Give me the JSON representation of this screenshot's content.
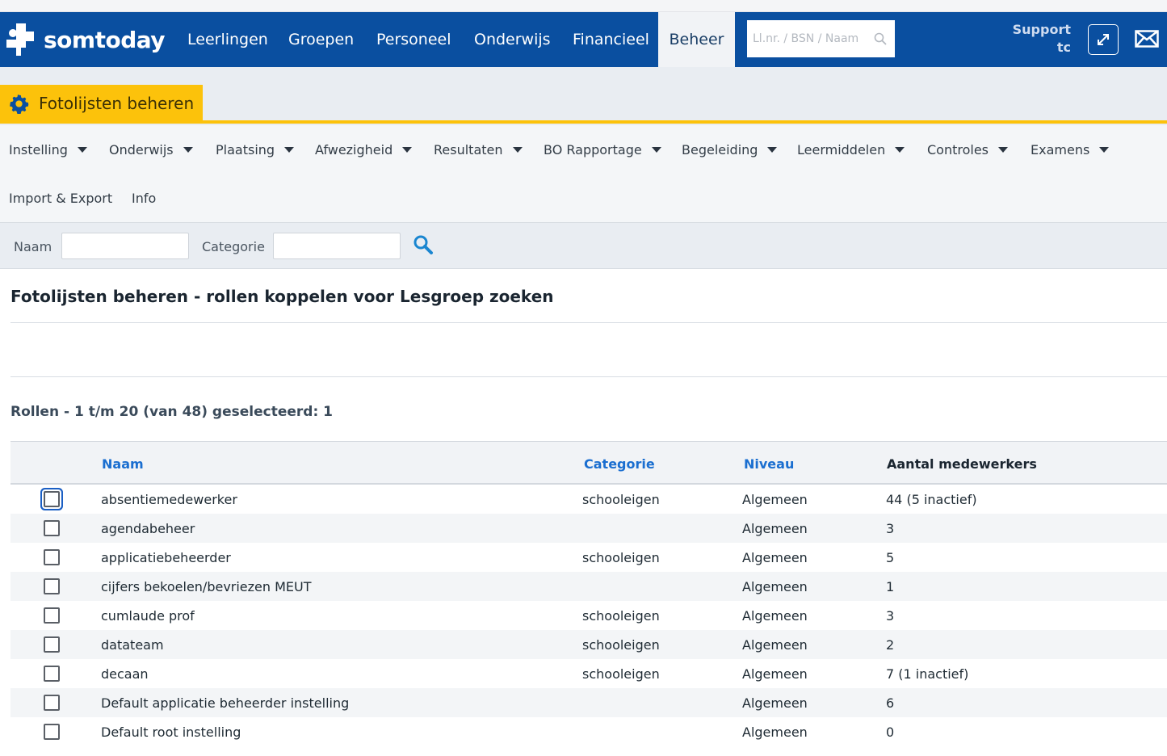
{
  "topnav": {
    "logo_text": "somtoday",
    "items": [
      {
        "label": "Leerlingen"
      },
      {
        "label": "Groepen"
      },
      {
        "label": "Personeel"
      },
      {
        "label": "Onderwijs"
      },
      {
        "label": "Financieel"
      },
      {
        "label": "Beheer",
        "active": true
      }
    ],
    "search_placeholder": "Ll.nr. / BSN / Naam",
    "support_line1": "Support",
    "support_line2": "tc"
  },
  "page": {
    "tab_title": "Fotolijsten beheren"
  },
  "menu": {
    "row1": [
      {
        "label": "Instelling"
      },
      {
        "label": "Onderwijs"
      },
      {
        "label": "Plaatsing"
      },
      {
        "label": "Afwezigheid"
      },
      {
        "label": "Resultaten"
      },
      {
        "label": "BO Rapportage"
      },
      {
        "label": "Begeleiding"
      },
      {
        "label": "Leermiddelen"
      },
      {
        "label": "Controles"
      },
      {
        "label": "Examens"
      }
    ],
    "row2": [
      {
        "label": "Import & Export"
      },
      {
        "label": "Info"
      }
    ]
  },
  "filter": {
    "naam_label": "Naam",
    "categorie_label": "Categorie"
  },
  "main": {
    "title": "Fotolijsten beheren - rollen koppelen voor Lesgroep zoeken",
    "count_text": "Rollen - 1 t/m 20 (van 48) geselecteerd: 1"
  },
  "table": {
    "columns": [
      "Naam",
      "Categorie",
      "Niveau",
      "Aantal medewerkers"
    ],
    "rows": [
      {
        "naam": "absentiemedewerker",
        "categorie": "schooleigen",
        "niveau": "Algemeen",
        "aantal": "44 (5 inactief)"
      },
      {
        "naam": "agendabeheer",
        "categorie": "",
        "niveau": "Algemeen",
        "aantal": "3"
      },
      {
        "naam": "applicatiebeheerder",
        "categorie": "schooleigen",
        "niveau": "Algemeen",
        "aantal": "5"
      },
      {
        "naam": "cijfers bekoelen/bevriezen MEUT",
        "categorie": "",
        "niveau": "Algemeen",
        "aantal": "1"
      },
      {
        "naam": "cumlaude prof",
        "categorie": "schooleigen",
        "niveau": "Algemeen",
        "aantal": "3"
      },
      {
        "naam": "datateam",
        "categorie": "schooleigen",
        "niveau": "Algemeen",
        "aantal": "2"
      },
      {
        "naam": "decaan",
        "categorie": "schooleigen",
        "niveau": "Algemeen",
        "aantal": "7 (1 inactief)"
      },
      {
        "naam": "Default applicatie beheerder instelling",
        "categorie": "",
        "niveau": "Algemeen",
        "aantal": "6"
      },
      {
        "naam": "Default root instelling",
        "categorie": "",
        "niveau": "Algemeen",
        "aantal": "0"
      }
    ]
  },
  "colors": {
    "nav_blue": "#0a4fa0",
    "accent_yellow": "#fcc20b",
    "link_blue": "#1a6ed0"
  }
}
